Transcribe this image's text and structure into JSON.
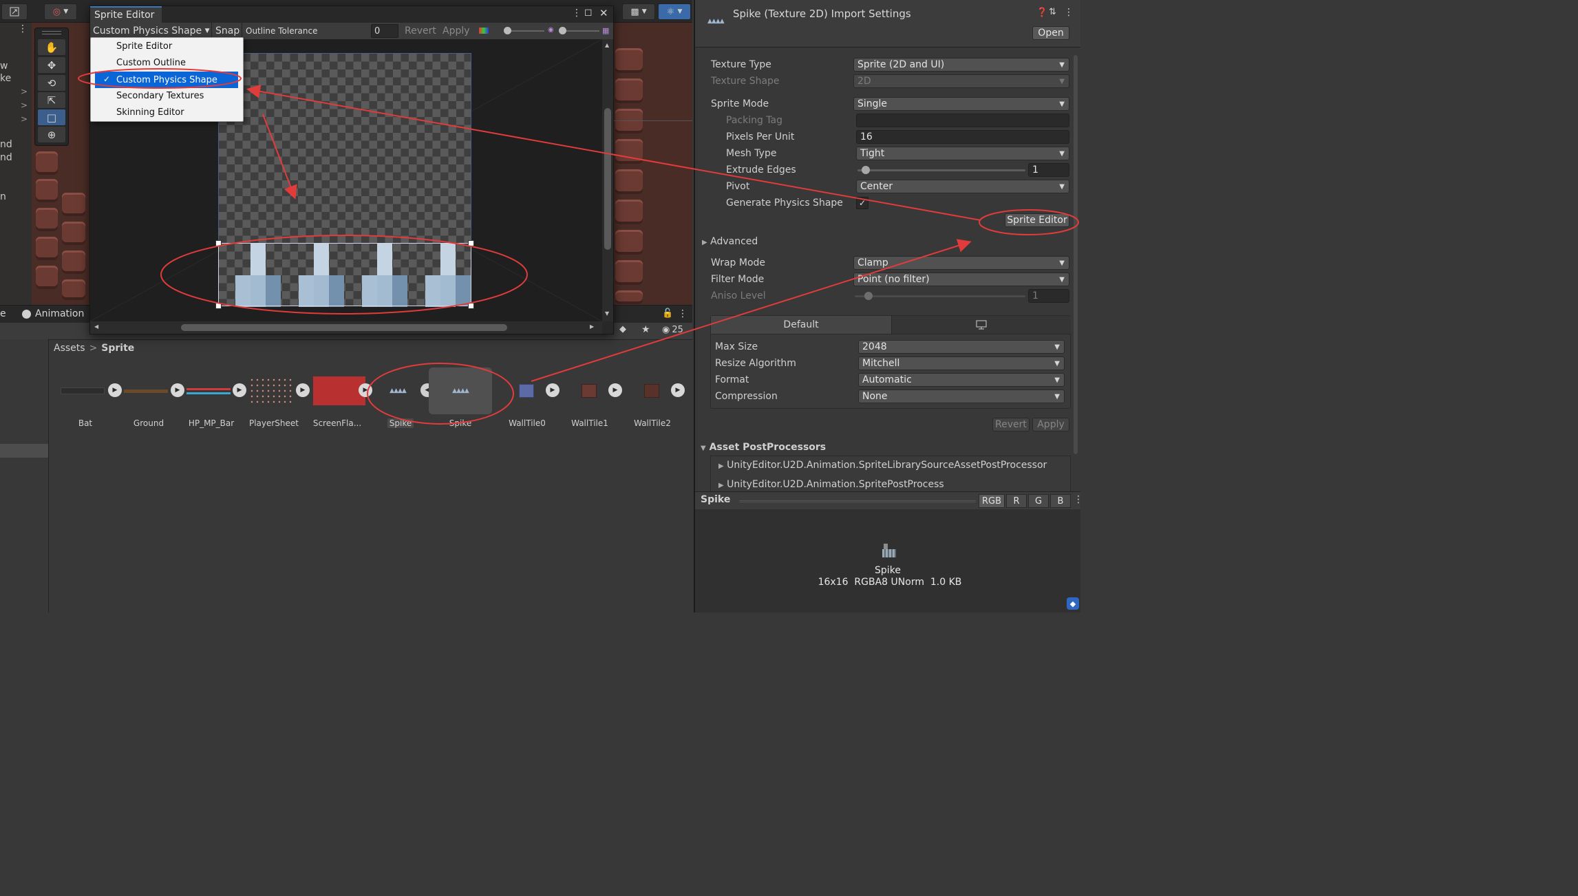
{
  "colors": {
    "accent": "#3a79bb",
    "selection": "#0a66d6",
    "annotation": "#e23b3b"
  },
  "left_edge_labels": [
    "w",
    "ke",
    "nd",
    "nd",
    "n"
  ],
  "sprite_editor": {
    "title": "Sprite Editor",
    "mode_dropdown": "Custom Physics Shape",
    "snap": "Snap",
    "outline_tolerance_label": "Outline Tolerance",
    "outline_tolerance_value": "0",
    "revert": "Revert",
    "apply": "Apply",
    "menu_items": [
      "Sprite Editor",
      "Custom Outline",
      "Custom Physics Shape",
      "Secondary Textures",
      "Skinning Editor"
    ],
    "selected_mode": "Custom Physics Shape"
  },
  "bottom_tabs": {
    "animation": "Animation"
  },
  "project": {
    "breadcrumb": [
      "Assets",
      "Sprite"
    ],
    "visibility_count": "25",
    "assets": [
      {
        "name": "Bat",
        "icon": "bat-strip"
      },
      {
        "name": "Ground",
        "icon": "ground-strip"
      },
      {
        "name": "HP_MP_Bar",
        "icon": "bar-strip"
      },
      {
        "name": "PlayerSheet",
        "icon": "dots-sheet"
      },
      {
        "name": "ScreenFla...",
        "icon": "red-block"
      },
      {
        "name": "Spike",
        "icon": "spike-texture"
      },
      {
        "name": "Spike",
        "icon": "spike-sprite"
      },
      {
        "name": "WallTile0",
        "icon": "wall-tile"
      },
      {
        "name": "WallTile1",
        "icon": "wall-tile"
      },
      {
        "name": "WallTile2",
        "icon": "wall-tile"
      }
    ]
  },
  "inspector": {
    "title": "Spike (Texture 2D) Import Settings",
    "open_button": "Open",
    "props": {
      "texture_type": {
        "label": "Texture Type",
        "value": "Sprite (2D and UI)"
      },
      "texture_shape": {
        "label": "Texture Shape",
        "value": "2D"
      },
      "sprite_mode": {
        "label": "Sprite Mode",
        "value": "Single"
      },
      "packing_tag": {
        "label": "Packing Tag",
        "value": ""
      },
      "pixels_per_unit": {
        "label": "Pixels Per Unit",
        "value": "16"
      },
      "mesh_type": {
        "label": "Mesh Type",
        "value": "Tight"
      },
      "extrude_edges": {
        "label": "Extrude Edges",
        "value": "1"
      },
      "pivot": {
        "label": "Pivot",
        "value": "Center"
      },
      "generate_physics_shape": {
        "label": "Generate Physics Shape",
        "checked": true
      }
    },
    "sprite_editor_button": "Sprite Editor",
    "advanced": "Advanced",
    "wrap_mode": {
      "label": "Wrap Mode",
      "value": "Clamp"
    },
    "filter_mode": {
      "label": "Filter Mode",
      "value": "Point (no filter)"
    },
    "aniso_level": {
      "label": "Aniso Level",
      "value": "1"
    },
    "platform": {
      "default_tab": "Default",
      "max_size": {
        "label": "Max Size",
        "value": "2048"
      },
      "resize_algorithm": {
        "label": "Resize Algorithm",
        "value": "Mitchell"
      },
      "format": {
        "label": "Format",
        "value": "Automatic"
      },
      "compression": {
        "label": "Compression",
        "value": "None"
      }
    },
    "revert": "Revert",
    "apply": "Apply",
    "postprocessors": {
      "header": "Asset PostProcessors",
      "items": [
        "UnityEditor.U2D.Animation.SpriteLibrarySourceAssetPostProcessor",
        "UnityEditor.U2D.Animation.SpritePostProcess"
      ]
    },
    "preview": {
      "name": "Spike",
      "channels": [
        "RGB",
        "R",
        "G",
        "B"
      ],
      "caption_name": "Spike",
      "caption_info": "16x16  RGBA8 UNorm  1.0 KB"
    }
  }
}
